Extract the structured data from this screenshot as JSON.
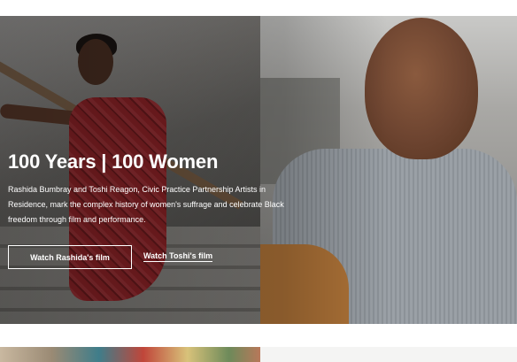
{
  "hero": {
    "title": "100 Years | 100 Women",
    "description": "Rashida Bumbray and Toshi Reagon, Civic Practice Partnership Artists in Residence, mark the complex history of women's suffrage and celebrate Black freedom through film and performance.",
    "primary_button_label": "Watch Rashida's film",
    "secondary_link_label": "Watch Toshi's film"
  },
  "colors": {
    "text_on_image": "#ffffff",
    "page_background": "#ffffff",
    "dress_red": "#8e2327"
  }
}
